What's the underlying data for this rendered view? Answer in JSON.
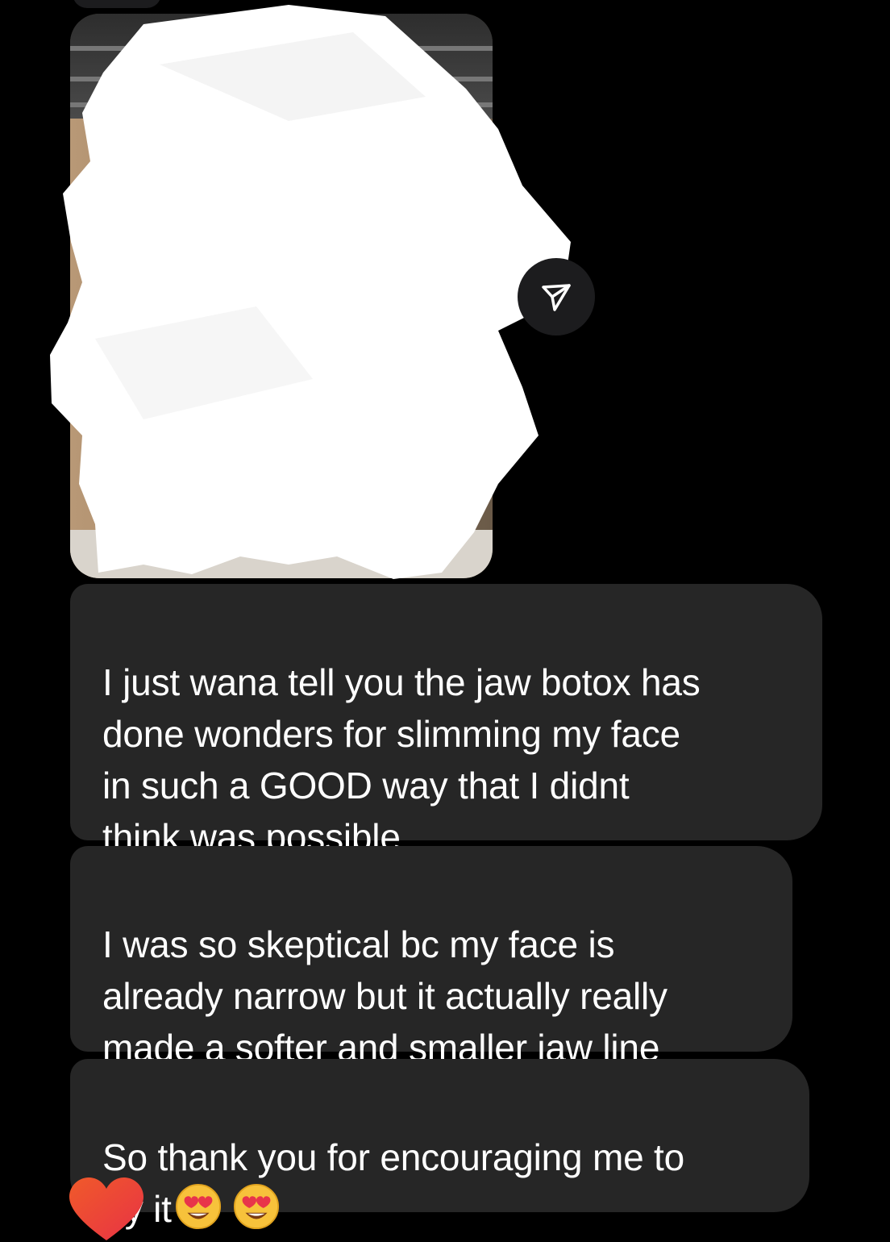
{
  "thread": {
    "shared_photo": {
      "redacted": true,
      "share_icon": "paper-plane-icon"
    },
    "messages": [
      {
        "text": "I just wana tell you the jaw botox has\ndone wonders for slimming my face\nin such a GOOD way that I didnt\nthink was possible"
      },
      {
        "text": "I was so skeptical bc my face is\nalready narrow but it actually really\nmade a softer and smaller jaw line"
      },
      {
        "text": "So thank you for encouraging me to\ntry it",
        "emojis": [
          "heart-eyes-emoji",
          "heart-eyes-emoji"
        ]
      }
    ],
    "reaction": {
      "icon": "heart-icon",
      "color": "#f0483e"
    },
    "colors": {
      "background": "#000000",
      "bubble": "#262626",
      "text": "#ffffff"
    }
  }
}
